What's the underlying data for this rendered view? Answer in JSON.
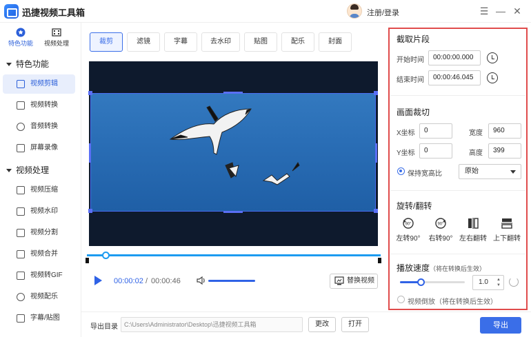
{
  "app": {
    "title": "迅捷视频工具箱",
    "login": "注册/登录"
  },
  "window_controls": {
    "menu": "☰",
    "minimize": "—",
    "close": "✕"
  },
  "sidebar": {
    "top_tabs": [
      {
        "label": "特色功能",
        "active": true
      },
      {
        "label": "视频处理",
        "active": false
      }
    ],
    "groups": [
      {
        "title": "特色功能",
        "items": [
          {
            "label": "视频剪辑",
            "active": true
          },
          {
            "label": "视频转换"
          },
          {
            "label": "音频转换"
          },
          {
            "label": "屏幕录像"
          }
        ]
      },
      {
        "title": "视频处理",
        "items": [
          {
            "label": "视频压缩"
          },
          {
            "label": "视频水印"
          },
          {
            "label": "视频分割"
          },
          {
            "label": "视频合并"
          },
          {
            "label": "视频转GIF"
          },
          {
            "label": "视频配乐"
          },
          {
            "label": "字幕/贴图"
          }
        ]
      }
    ]
  },
  "toolbar": {
    "tabs": [
      "裁剪",
      "滤镜",
      "字幕",
      "去水印",
      "贴图",
      "配乐",
      "封面"
    ],
    "active_index": 0
  },
  "player": {
    "current_time": "00:00:02",
    "separator": "/",
    "total_time": "00:00:46",
    "replace_label": "替换视频",
    "progress": 0.05
  },
  "bottom": {
    "export_dir_label": "导出目录",
    "export_path": "C:\\Users\\Administrator\\Desktop\\迅捷视频工具箱",
    "change_label": "更改",
    "open_label": "打开",
    "export_label": "导出"
  },
  "panel": {
    "clip": {
      "title": "截取片段",
      "start_label": "开始时间",
      "start_value": "00:00:00.000",
      "end_label": "结束时间",
      "end_value": "00:00:46.045"
    },
    "crop": {
      "title": "画面裁切",
      "x_label": "X坐标",
      "x_value": "0",
      "w_label": "宽度",
      "w_value": "960",
      "y_label": "Y坐标",
      "y_value": "0",
      "h_label": "高度",
      "h_value": "399",
      "keep_ratio_label": "保持宽高比",
      "ratio_value": "原始"
    },
    "rotate": {
      "title": "旋转/翻转",
      "buttons": [
        "左转90°",
        "右转90°",
        "左右翻转",
        "上下翻转"
      ]
    },
    "speed": {
      "title": "播放速度",
      "note": "（将在转换后生效）",
      "value": "1.0",
      "level": 0.33,
      "reverse_label": "视频倒放",
      "reverse_note": "（将在转换后生效）"
    }
  },
  "colors": {
    "accent": "#3a6ee8",
    "highlight_border": "#e04b4b",
    "timeline": "#1c9bf0"
  }
}
